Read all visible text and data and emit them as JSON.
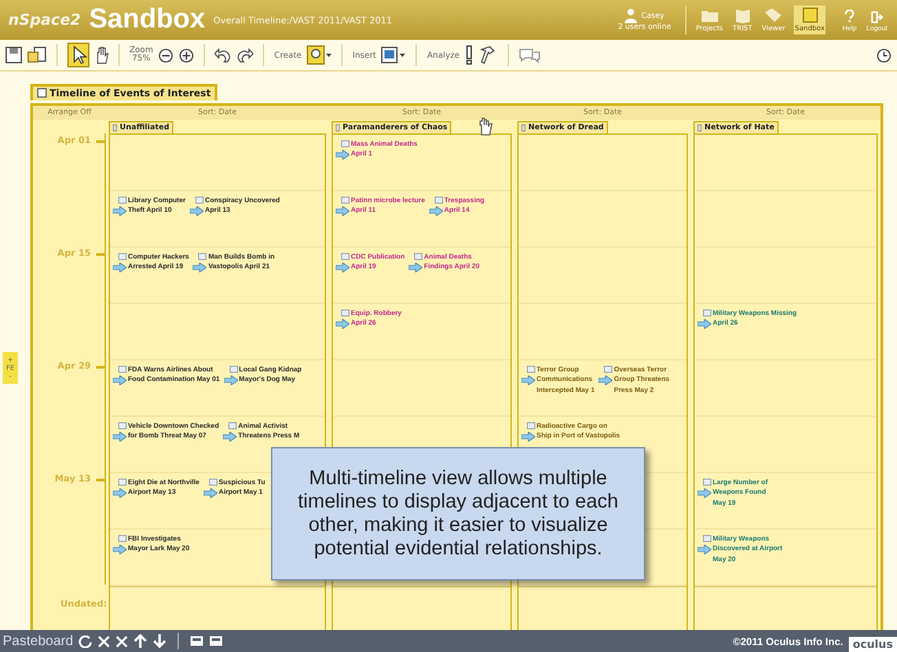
{
  "header": {
    "brand": "nSpace2",
    "title": "Sandbox",
    "path": "Overall Timeline:/VAST 2011/VAST 2011",
    "user": "Casey",
    "online": "2 users online",
    "nav": [
      {
        "label": "Projects",
        "selected": false
      },
      {
        "label": "TRIST",
        "selected": false
      },
      {
        "label": "Viewer",
        "selected": false
      },
      {
        "label": "Sandbox",
        "selected": true
      }
    ],
    "help": "Help",
    "logout": "Logout"
  },
  "toolbar": {
    "zoom_label": "Zoom",
    "zoom_value": "75%",
    "create": "Create",
    "insert": "Insert",
    "analyze": "Analyze"
  },
  "panel": {
    "title": "Timeline of Events of Interest",
    "arrange": "Arrange Off",
    "sorts": [
      "Sort: Date",
      "Sort: Date",
      "Sort: Date",
      "Sort: Date"
    ],
    "date_marks": [
      "Apr 01",
      "Apr 15",
      "Apr 29",
      "May 13"
    ],
    "undated": "Undated:",
    "filter": {
      "expand": "+",
      "label": "FE",
      "collapse": "-"
    },
    "lanes": [
      {
        "title": "Unaffiliated",
        "color": "#2a2a2a",
        "cells": [
          [],
          [
            {
              "lines": [
                "Library Computer",
                "Theft April 10"
              ]
            },
            {
              "lines": [
                "Conspiracy Uncovered",
                "April 13"
              ]
            }
          ],
          [
            {
              "lines": [
                "Computer Hackers",
                "Arrested April 19"
              ]
            },
            {
              "lines": [
                "Man Builds Bomb in",
                "Vastopolis April 21"
              ]
            }
          ],
          [],
          [
            {
              "lines": [
                "FDA Warns Airlines About",
                "Food Contamination May 01"
              ]
            },
            {
              "lines": [
                "Local Gang Kidnap",
                "Mayor's Dog May"
              ]
            }
          ],
          [
            {
              "lines": [
                "Vehicle Downtown Checked",
                "for Bomb Threat May 07"
              ]
            },
            {
              "lines": [
                "Animal Activist",
                "Threatens Press M"
              ]
            }
          ],
          [
            {
              "lines": [
                "Eight Die at Northville",
                "Airport May 13"
              ]
            },
            {
              "lines": [
                "Suspicious Tu",
                "Airport May 1"
              ]
            }
          ],
          [
            {
              "lines": [
                "FBI Investigates",
                "Mayor Lark May 20"
              ]
            }
          ]
        ]
      },
      {
        "title": "Paramanderers of Chaos",
        "color": "#c02a8c",
        "cells": [
          [
            {
              "lines": [
                "Mass Animal Deaths",
                "April 1"
              ]
            }
          ],
          [
            {
              "lines": [
                "Patinn microbe lecture",
                "April 11"
              ]
            },
            {
              "lines": [
                "Trespassing",
                "April 14"
              ]
            }
          ],
          [
            {
              "lines": [
                "CDC Publication",
                "April 19"
              ]
            },
            {
              "lines": [
                "Animal Deaths",
                "Findings April 20"
              ]
            }
          ],
          [
            {
              "lines": [
                "Equip. Robbery",
                "April 26"
              ]
            }
          ],
          [],
          [],
          [],
          []
        ]
      },
      {
        "title": "Network of Dread",
        "color": "#7a5c12",
        "cells": [
          [],
          [],
          [],
          [],
          [
            {
              "lines": [
                "Terror Group",
                "Communications",
                "Intercepted May 1"
              ]
            },
            {
              "lines": [
                "Overseas Terror",
                "Group Threatens",
                "Press May 2"
              ]
            }
          ],
          [
            {
              "lines": [
                "Radioactive Cargo on",
                "Ship in Port of Vastopolis"
              ]
            }
          ],
          [],
          []
        ]
      },
      {
        "title": "Network of Hate",
        "color": "#1a7a6e",
        "cells": [
          [],
          [],
          [],
          [
            {
              "lines": [
                "Military Weapons Missing",
                "April 26"
              ]
            }
          ],
          [],
          [],
          [
            {
              "lines": [
                "Large Number of",
                "Weapons Found",
                "May 19"
              ]
            }
          ],
          [
            {
              "lines": [
                "Military Weapons",
                "Discovered at Airport",
                "May 20"
              ]
            }
          ]
        ]
      }
    ]
  },
  "callout": "Multi-timeline view allows multiple timelines to display adjacent to each other, making it easier to visualize potential evidential relationships.",
  "footer": {
    "pasteboard": "Pasteboard",
    "copyright": "©2011 Oculus Info Inc.",
    "logo": "oculus"
  }
}
